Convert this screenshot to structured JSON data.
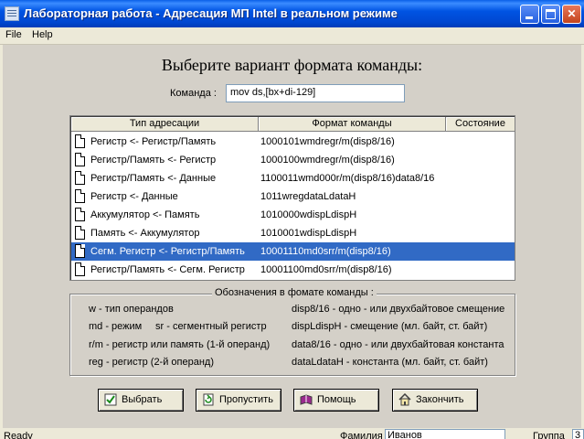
{
  "window": {
    "title": "Лабораторная работа - Адресация МП Intel в реальном режиме"
  },
  "menu": {
    "file": "File",
    "help": "Help"
  },
  "heading": "Выберите вариант формата команды:",
  "command": {
    "label": "Команда :",
    "value": "mov ds,[bx+di-129]"
  },
  "table": {
    "columns": [
      "Тип адресации",
      "Формат команды",
      "Состояние"
    ],
    "rows": [
      {
        "type": "Регистр <- Регистр/Память",
        "format": "1000101wmdregr/m(disp8/16)",
        "state": ""
      },
      {
        "type": "Регистр/Память <- Регистр",
        "format": "1000100wmdregr/m(disp8/16)",
        "state": ""
      },
      {
        "type": "Регистр/Память <- Данные",
        "format": "1100011wmd000r/m(disp8/16)data8/16",
        "state": ""
      },
      {
        "type": "Регистр <- Данные",
        "format": "1011wregdataLdataH",
        "state": ""
      },
      {
        "type": "Аккумулятор <- Память",
        "format": "1010000wdispLdispH",
        "state": ""
      },
      {
        "type": "Память <- Аккумулятор",
        "format": "1010001wdispLdispH",
        "state": ""
      },
      {
        "type": "Сегм. Регистр <- Регистр/Память",
        "format": "10001110md0srr/m(disp8/16)",
        "state": "",
        "selected": true
      },
      {
        "type": "Регистр/Память <- Сегм. Регистр",
        "format": "10001100md0srr/m(disp8/16)",
        "state": ""
      }
    ]
  },
  "legend": {
    "title": "Обозначения в фомате команды :",
    "w": "w - тип операндов",
    "md": "md - режим",
    "sr": "sr - сегментный регистр",
    "rm": "r/m - регистр или память (1-й операнд)",
    "reg": "reg - регистр (2-й операнд)",
    "disp816": "disp8/16 - одно - или двухбайтовое смещение",
    "displ": "dispLdispH - смещение (мл. байт, ст. байт)",
    "data816": "data8/16 - одно - или двухбайтовая константа",
    "datal": "dataLdataH - константа (мл. байт, ст. байт)"
  },
  "buttons": {
    "select": "Выбрать",
    "skip": "Пропустить",
    "help": "Помощь",
    "finish": "Закончить"
  },
  "status": {
    "text": "Ready",
    "surname_label": "Фамилия",
    "surname_value": "Иванов",
    "group_label": "Группа",
    "group_value": "3"
  },
  "icons": {
    "app": "app-window-icon",
    "select": "check-icon",
    "skip": "refresh-icon",
    "help": "book-icon",
    "finish": "home-icon",
    "row": "document-icon"
  },
  "colors": {
    "titlebar": "#0054e3",
    "selection": "#316ac5",
    "face": "#d4d0c8"
  }
}
